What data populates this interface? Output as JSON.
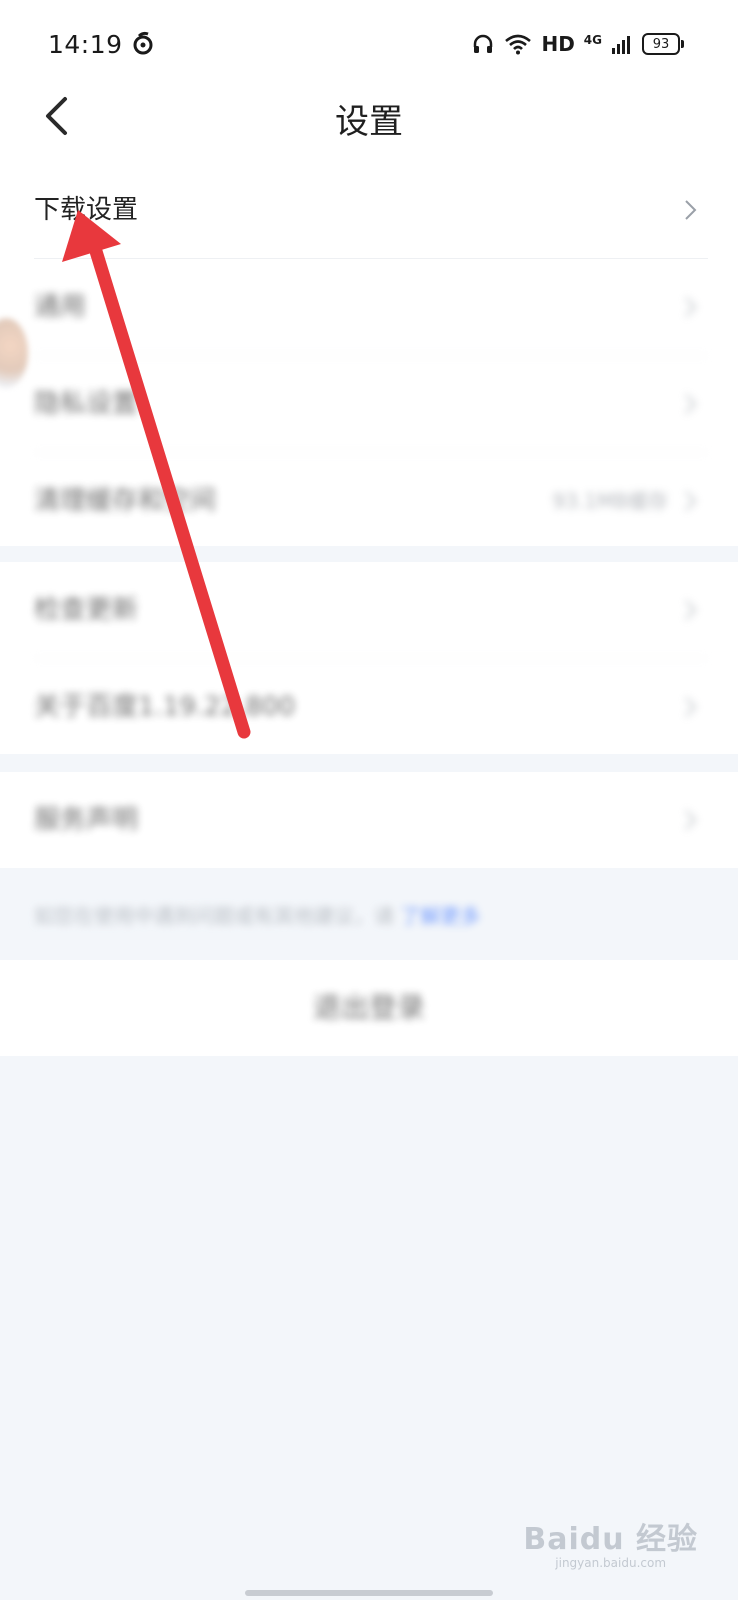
{
  "status_bar": {
    "time": "14:19",
    "network": "4G",
    "hd_label": "HD",
    "battery": "93"
  },
  "header": {
    "title": "设置"
  },
  "settings": {
    "group1": [
      {
        "label": "下载设置"
      },
      {
        "label": "通用"
      },
      {
        "label": "隐私设置"
      },
      {
        "label": "清理缓存和空间",
        "value": "93.1MB缓存"
      }
    ],
    "group2": [
      {
        "label": "检查更新"
      },
      {
        "label": "关于百度1.19.22.800"
      }
    ],
    "group3": [
      {
        "label": "服务声明"
      }
    ]
  },
  "notice": {
    "text": "如您在使用中遇到问题或有其他建议，请",
    "link": "了解更多"
  },
  "logout": {
    "label": "退出登录"
  },
  "watermark": {
    "brand": "Baidu 经验",
    "site": "jingyan.baidu.com"
  },
  "colors": {
    "accent_link": "#2f6bff",
    "annotation_arrow": "#e8383d",
    "page_background": "#f3f6fa"
  }
}
